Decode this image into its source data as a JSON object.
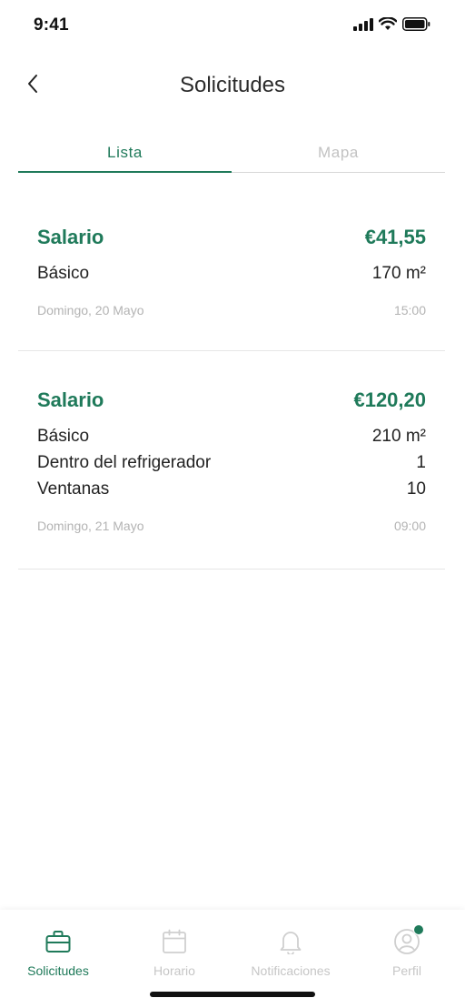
{
  "status_bar": {
    "time": "9:41"
  },
  "header": {
    "title": "Solicitudes",
    "back_icon": "chevron-left-icon"
  },
  "tabs": [
    {
      "label": "Lista",
      "active": true
    },
    {
      "label": "Mapa",
      "active": false
    }
  ],
  "requests": [
    {
      "title": "Salario",
      "price": "€41,55",
      "items": [
        {
          "name": "Básico",
          "value": "170 m²"
        }
      ],
      "date": "Domingo, 20 Mayo",
      "time": "15:00"
    },
    {
      "title": "Salario",
      "price": "€120,20",
      "items": [
        {
          "name": "Básico",
          "value": "210 m²"
        },
        {
          "name": "Dentro del refrigerador",
          "value": "1"
        },
        {
          "name": "Ventanas",
          "value": "10"
        }
      ],
      "date": "Domingo, 21 Mayo",
      "time": "09:00"
    }
  ],
  "tab_bar": [
    {
      "label": "Solicitudes",
      "icon": "briefcase-icon",
      "active": true
    },
    {
      "label": "Horario",
      "icon": "calendar-icon",
      "active": false
    },
    {
      "label": "Notificaciones",
      "icon": "bell-icon",
      "active": false
    },
    {
      "label": "Perfil",
      "icon": "profile-icon",
      "active": false,
      "badge": true
    }
  ],
  "colors": {
    "accent": "#1f7a5a",
    "inactive": "#c2c2c2",
    "divider": "#e6e6e6"
  }
}
